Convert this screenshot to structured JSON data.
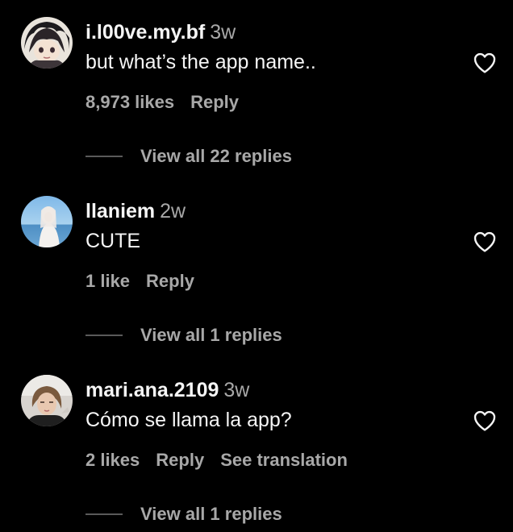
{
  "comments": [
    {
      "username": "i.l00ve.my.bf",
      "time": "3w",
      "text": "but what’s the app name..",
      "likes": "8,973 likes",
      "reply": "Reply",
      "translate": "",
      "view_replies": "View all 22 replies",
      "avatar": "anime-avatar"
    },
    {
      "username": "llaniem",
      "time": "2w",
      "text": "CUTE",
      "likes": "1 like",
      "reply": "Reply",
      "translate": "",
      "view_replies": "View all 1 replies",
      "avatar": "beach-avatar"
    },
    {
      "username": "mari.ana.2109",
      "time": "3w",
      "text": "Cómo se llama la app?",
      "likes": "2 likes",
      "reply": "Reply",
      "translate": "See translation",
      "view_replies": "View all 1 replies",
      "avatar": "photo-avatar"
    }
  ],
  "colors": {
    "background": "#000000",
    "primary_text": "#f5f5f5",
    "secondary_text": "#a8a8a8",
    "divider": "#5a5a5a"
  },
  "icons": {
    "like": "heart-outline-icon"
  }
}
